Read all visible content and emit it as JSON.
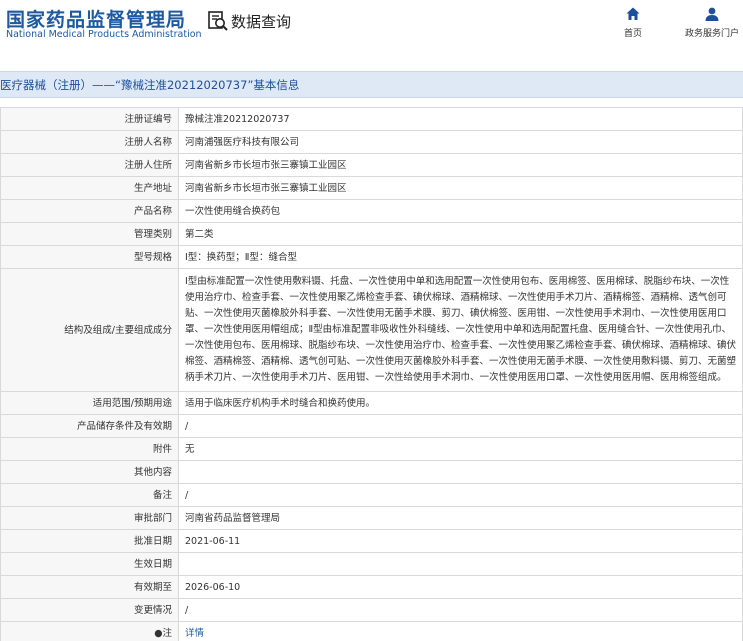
{
  "header": {
    "logo_cn": "国家药品监督管理局",
    "logo_en": "National Medical Products Administration",
    "search_title": "数据查询",
    "nav": [
      {
        "label": "首页",
        "icon": "home-icon"
      },
      {
        "label": "政务服务门户",
        "icon": "user-icon"
      }
    ]
  },
  "title": "医疗器械（注册）——“豫械注准20212020737”基本信息",
  "rows": [
    {
      "label": "注册证编号",
      "value": "豫械注准20212020737"
    },
    {
      "label": "注册人名称",
      "value": "河南浦强医疗科技有限公司"
    },
    {
      "label": "注册人住所",
      "value": "河南省新乡市长垣市张三寨镇工业园区"
    },
    {
      "label": "生产地址",
      "value": "河南省新乡市长垣市张三寨镇工业园区"
    },
    {
      "label": "产品名称",
      "value": "一次性使用缝合换药包"
    },
    {
      "label": "管理类别",
      "value": "第二类"
    },
    {
      "label": "型号规格",
      "value": "Ⅰ型：换药型；Ⅱ型：缝合型"
    },
    {
      "label": "结构及组成/主要组成成分",
      "value": "Ⅰ型由标准配置一次性使用敷料镊、托盘、一次性使用中单和选用配置一次性使用包布、医用棉签、医用棉球、脱脂纱布块、一次性使用治疗巾、检查手套、一次性使用聚乙烯检查手套、碘伏棉球、酒精棉球、一次性使用手术刀片、酒精棉签、酒精棉、透气创可贴、一次性使用灭菌橡胶外科手套、一次性使用无菌手术膜、剪刀、碘伏棉签、医用钳、一次性使用手术洞巾、一次性使用医用口罩、一次性使用医用帽组成；Ⅱ型由标准配置非吸收性外科缝线、一次性使用中单和选用配置托盘、医用缝合针、一次性使用孔巾、一次性使用包布、医用棉球、脱脂纱布块、一次性使用治疗巾、检查手套、一次性使用聚乙烯检查手套、碘伏棉球、酒精棉球、碘伏棉签、酒精棉签、酒精棉、透气创可贴、一次性使用灭菌橡胶外科手套、一次性使用无菌手术膜、一次性使用敷料镊、剪刀、无菌塑柄手术刀片、一次性使用手术刀片、医用钳、一次性给使用手术洞巾、一次性使用医用口罩、一次性使用医用帽、医用棉签组成。",
      "tall": true
    },
    {
      "label": "适用范围/预期用途",
      "value": "适用于临床医疗机构手术时缝合和换药使用。"
    },
    {
      "label": "产品储存条件及有效期",
      "value": "/"
    },
    {
      "label": "附件",
      "value": "无"
    },
    {
      "label": "其他内容",
      "value": ""
    },
    {
      "label": "备注",
      "value": "/"
    },
    {
      "label": "审批部门",
      "value": "河南省药品监督管理局"
    },
    {
      "label": "批准日期",
      "value": "2021-06-11"
    },
    {
      "label": "生效日期",
      "value": ""
    },
    {
      "label": "有效期至",
      "value": "2026-06-10"
    },
    {
      "label": "变更情况",
      "value": "/"
    },
    {
      "label": "●注",
      "value": "详情",
      "link": true
    }
  ]
}
